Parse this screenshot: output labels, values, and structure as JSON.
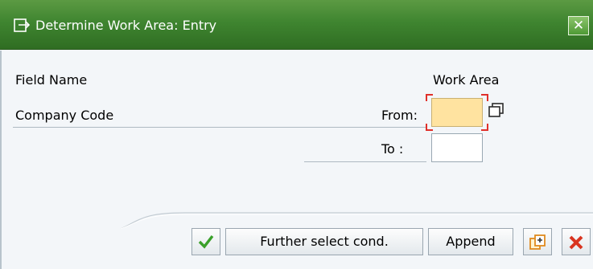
{
  "dialog": {
    "title": "Determine Work Area: Entry",
    "close_icon": "close-icon",
    "window_icon": "window-entry-icon"
  },
  "table": {
    "col_field_name": "Field Name",
    "col_work_area": "Work Area",
    "rows": [
      {
        "label": "Company Code",
        "from_label": "From:",
        "to_label": "To :",
        "from_value": "",
        "to_value": ""
      }
    ]
  },
  "buttons": {
    "ok_icon": "check-icon",
    "further_select": "Further select cond.",
    "append": "Append",
    "copy_icon": "copy-icon",
    "cancel_icon": "cancel-icon"
  },
  "colors": {
    "titlebar": "#3f8530",
    "required_field": "#ffe3a0",
    "focus": "#e0302a",
    "ok_green": "#3aa02a",
    "cancel_red": "#d9341f"
  }
}
